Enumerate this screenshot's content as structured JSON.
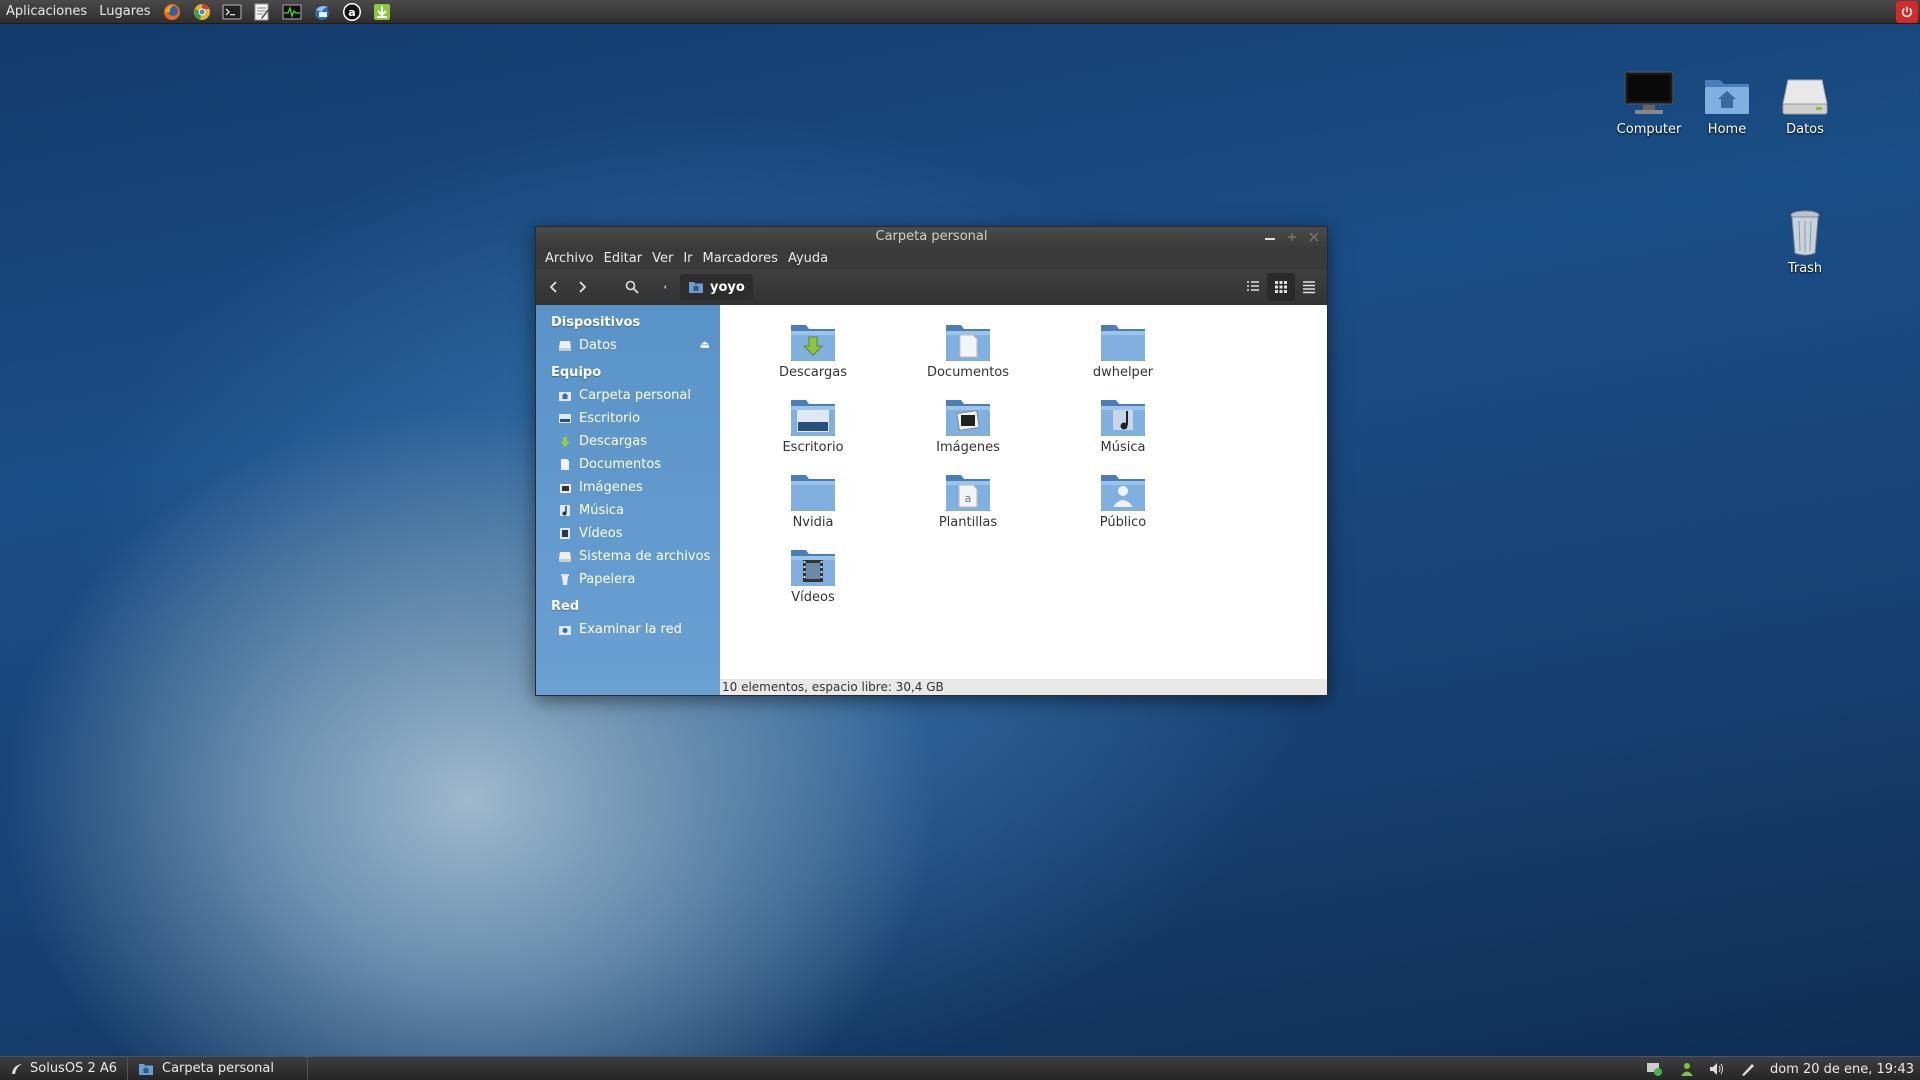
{
  "top_panel": {
    "menus": [
      "Aplicaciones",
      "Lugares"
    ],
    "launchers": [
      "firefox-icon",
      "chrome-icon",
      "terminal-icon",
      "text-editor-icon",
      "system-monitor-icon",
      "thunderbird-icon",
      "amule-icon",
      "download-manager-icon"
    ]
  },
  "desktop": {
    "icons": [
      {
        "label": "Computer",
        "icon": "monitor-icon"
      },
      {
        "label": "Home",
        "icon": "home-folder-icon"
      },
      {
        "label": "Datos",
        "icon": "drive-icon"
      },
      {
        "label": "Trash",
        "icon": "trash-icon"
      }
    ]
  },
  "window": {
    "title": "Carpeta personal",
    "menu": [
      "Archivo",
      "Editar",
      "Ver",
      "Ir",
      "Marcadores",
      "Ayuda"
    ],
    "path": "yoyo",
    "sidebar": {
      "sections": [
        {
          "title": "Dispositivos",
          "items": [
            {
              "label": "Datos",
              "icon": "drive-icon",
              "eject": "⏏"
            }
          ]
        },
        {
          "title": "Equipo",
          "items": [
            {
              "label": "Carpeta personal",
              "icon": "home-icon"
            },
            {
              "label": "Escritorio",
              "icon": "desktop-icon"
            },
            {
              "label": "Descargas",
              "icon": "download-icon"
            },
            {
              "label": "Documentos",
              "icon": "document-icon"
            },
            {
              "label": "Imágenes",
              "icon": "image-icon"
            },
            {
              "label": "Música",
              "icon": "music-icon"
            },
            {
              "label": "Vídeos",
              "icon": "video-icon"
            },
            {
              "label": "Sistema de archivos",
              "icon": "filesystem-icon"
            },
            {
              "label": "Papelera",
              "icon": "trash-icon"
            }
          ]
        },
        {
          "title": "Red",
          "items": [
            {
              "label": "Examinar la red",
              "icon": "network-icon"
            }
          ]
        }
      ]
    },
    "files": [
      {
        "label": "Descargas",
        "emblem": "download"
      },
      {
        "label": "Documentos",
        "emblem": "document"
      },
      {
        "label": "dwhelper",
        "emblem": "none"
      },
      {
        "label": "Escritorio",
        "emblem": "desktop"
      },
      {
        "label": "Imágenes",
        "emblem": "image"
      },
      {
        "label": "Música",
        "emblem": "music"
      },
      {
        "label": "Nvidia",
        "emblem": "none"
      },
      {
        "label": "Plantillas",
        "emblem": "template"
      },
      {
        "label": "Público",
        "emblem": "user"
      },
      {
        "label": "Vídeos",
        "emblem": "video"
      }
    ],
    "status": "10 elementos, espacio libre: 30,4 GB"
  },
  "bottom_panel": {
    "start_label": "SolusOS 2 A6",
    "task_label": "Carpeta personal",
    "clock": "dom 20 de ene, 19:43"
  },
  "colors": {
    "sidebar": "#5f98cc",
    "folder": "#6a9ed2",
    "power": "#d42a2a"
  }
}
